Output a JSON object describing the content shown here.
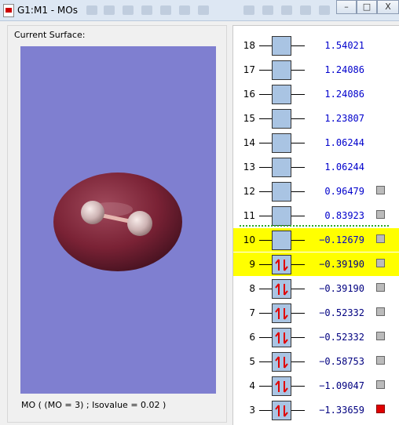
{
  "window": {
    "title": "G1:M1 - MOs",
    "minimize": "–",
    "restore": "□",
    "close": "X"
  },
  "left_panel": {
    "surface_label": "Current Surface:",
    "caption": "MO ( (MO = 3) ; Isovalue = 0.02 )"
  },
  "colors": {
    "viewport_bg": "#7f7fd0",
    "highlight": "#ffff00",
    "electron_arrow": "#e00000",
    "occupied_energy": "#000080",
    "virtual_energy": "#0000cc",
    "selected_checkbox": "#e00000",
    "homo_lumo_divider": "#2fa82f"
  },
  "orbitals": [
    {
      "num": "18",
      "energy": "1.54021",
      "occupied": false,
      "highlight": false,
      "checkbox": "none"
    },
    {
      "num": "17",
      "energy": "1.24086",
      "occupied": false,
      "highlight": false,
      "checkbox": "none"
    },
    {
      "num": "16",
      "energy": "1.24086",
      "occupied": false,
      "highlight": false,
      "checkbox": "none"
    },
    {
      "num": "15",
      "energy": "1.23807",
      "occupied": false,
      "highlight": false,
      "checkbox": "none"
    },
    {
      "num": "14",
      "energy": "1.06244",
      "occupied": false,
      "highlight": false,
      "checkbox": "none"
    },
    {
      "num": "13",
      "energy": "1.06244",
      "occupied": false,
      "highlight": false,
      "checkbox": "none"
    },
    {
      "num": "12",
      "energy": "0.96479",
      "occupied": false,
      "highlight": false,
      "checkbox": "gray"
    },
    {
      "num": "11",
      "energy": "0.83923",
      "occupied": false,
      "highlight": false,
      "checkbox": "gray"
    },
    {
      "num": "10",
      "energy": "−0.12679",
      "occupied": false,
      "highlight": true,
      "checkbox": "gray"
    },
    {
      "num": "9",
      "energy": "−0.39190",
      "occupied": true,
      "highlight": true,
      "checkbox": "gray"
    },
    {
      "num": "8",
      "energy": "−0.39190",
      "occupied": true,
      "highlight": false,
      "checkbox": "gray"
    },
    {
      "num": "7",
      "energy": "−0.52332",
      "occupied": true,
      "highlight": false,
      "checkbox": "gray"
    },
    {
      "num": "6",
      "energy": "−0.52332",
      "occupied": true,
      "highlight": false,
      "checkbox": "gray"
    },
    {
      "num": "5",
      "energy": "−0.58753",
      "occupied": true,
      "highlight": false,
      "checkbox": "gray"
    },
    {
      "num": "4",
      "energy": "−1.09047",
      "occupied": true,
      "highlight": false,
      "checkbox": "gray"
    },
    {
      "num": "3",
      "energy": "−1.33659",
      "occupied": true,
      "highlight": false,
      "checkbox": "red"
    }
  ]
}
